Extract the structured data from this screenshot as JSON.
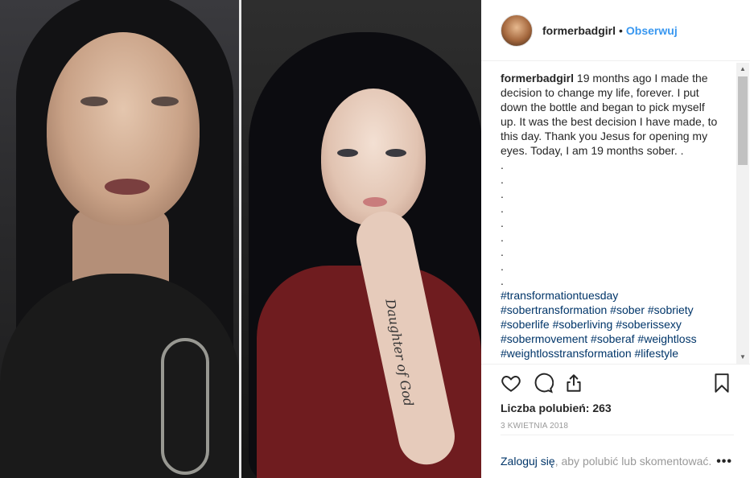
{
  "post": {
    "username": "formerbadgirl",
    "separator": "•",
    "follow_label": "Obserwuj",
    "caption_username": "formerbadgirl",
    "caption_text": "19 months ago I made the decision to change my life, forever. I put down the bottle and began to pick myself up. It was the best decision I have made, to this day. Thank you Jesus for opening my eyes. Today, I am 19 months sober. .",
    "caption_dots": [
      ".",
      ".",
      ".",
      ".",
      ".",
      ".",
      ".",
      ".",
      "."
    ],
    "hashtags_line1": "#transformationtuesday",
    "hashtags_line2": "#sobertransformation #sober #sobriety",
    "hashtags_line3": "#soberlife #soberliving #soberissexy",
    "hashtags_line4": "#sobermovement #soberaf #weightloss",
    "hashtags_line5": "#weightlosstransformation #lifestyle",
    "likes_label": "Liczba polubień: 263",
    "date": "3 KWIETNIA 2018",
    "login_link": "Zaloguj się",
    "login_rest": ", aby polubić lub skomentować.",
    "more": "•••"
  },
  "photo": {
    "tattoo_text": "Daughter of God"
  },
  "icons": {
    "like": "heart-outline-icon",
    "comment": "speech-bubble-icon",
    "share": "share-upload-icon",
    "save": "bookmark-icon"
  },
  "colors": {
    "link_blue": "#3897f0",
    "hashtag_blue": "#003569",
    "text": "#262626",
    "muted": "#999999"
  }
}
